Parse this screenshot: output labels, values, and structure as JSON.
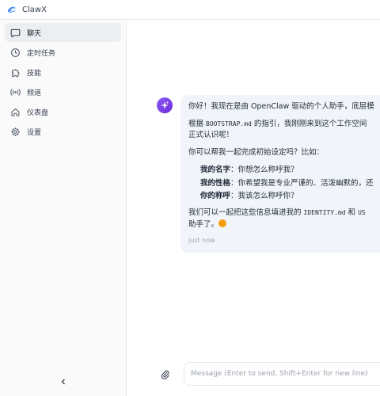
{
  "app": {
    "title": "ClawX",
    "logo_icon": "crab-claw-logo"
  },
  "colors": {
    "accent": "#7c3aed",
    "sidebar_bg": "#fafafa",
    "bubble_bg": "#f1f5f9"
  },
  "sidebar": {
    "items": [
      {
        "label": "聊天",
        "icon": "chat-icon",
        "active": true
      },
      {
        "label": "定时任务",
        "icon": "clock-icon"
      },
      {
        "label": "技能",
        "icon": "puzzle-icon"
      },
      {
        "label": "频道",
        "icon": "radio-icon"
      },
      {
        "label": "仪表盘",
        "icon": "home-icon"
      },
      {
        "label": "设置",
        "icon": "gear-icon"
      }
    ],
    "collapse_icon": "chevron-left-icon"
  },
  "chat": {
    "message": {
      "p1": "你好！我现在是由 OpenClaw 驱动的个人助手，底层模",
      "p2_pre": "根据 ",
      "p2_code": "BOOTSTRAP.md",
      "p2_post": " 的指引，我刚刚来到这个工作空间",
      "p2_line2": "正式认识呢！",
      "p3": "你可以帮我一起完成初始设定吗？比如：",
      "bullets": [
        {
          "key": "我的名字",
          "text": "：你想怎么称呼我？"
        },
        {
          "key": "我的性格",
          "text": "：你希望我是专业严谨的、活泼幽默的，还"
        },
        {
          "key": "你的称呼",
          "text": "：我该怎么称呼你？"
        }
      ],
      "p4_pre": "我们可以一起把这些信息填进我的 ",
      "p4_code": "IDENTITY.md",
      "p4_mid": " 和 ",
      "p4_code2": "US",
      "p4_line2": "助手了。",
      "timestamp": "just now"
    },
    "composer": {
      "placeholder": "Message (Enter to send, Shift+Enter for new line)",
      "attach_icon": "paperclip-icon"
    }
  }
}
